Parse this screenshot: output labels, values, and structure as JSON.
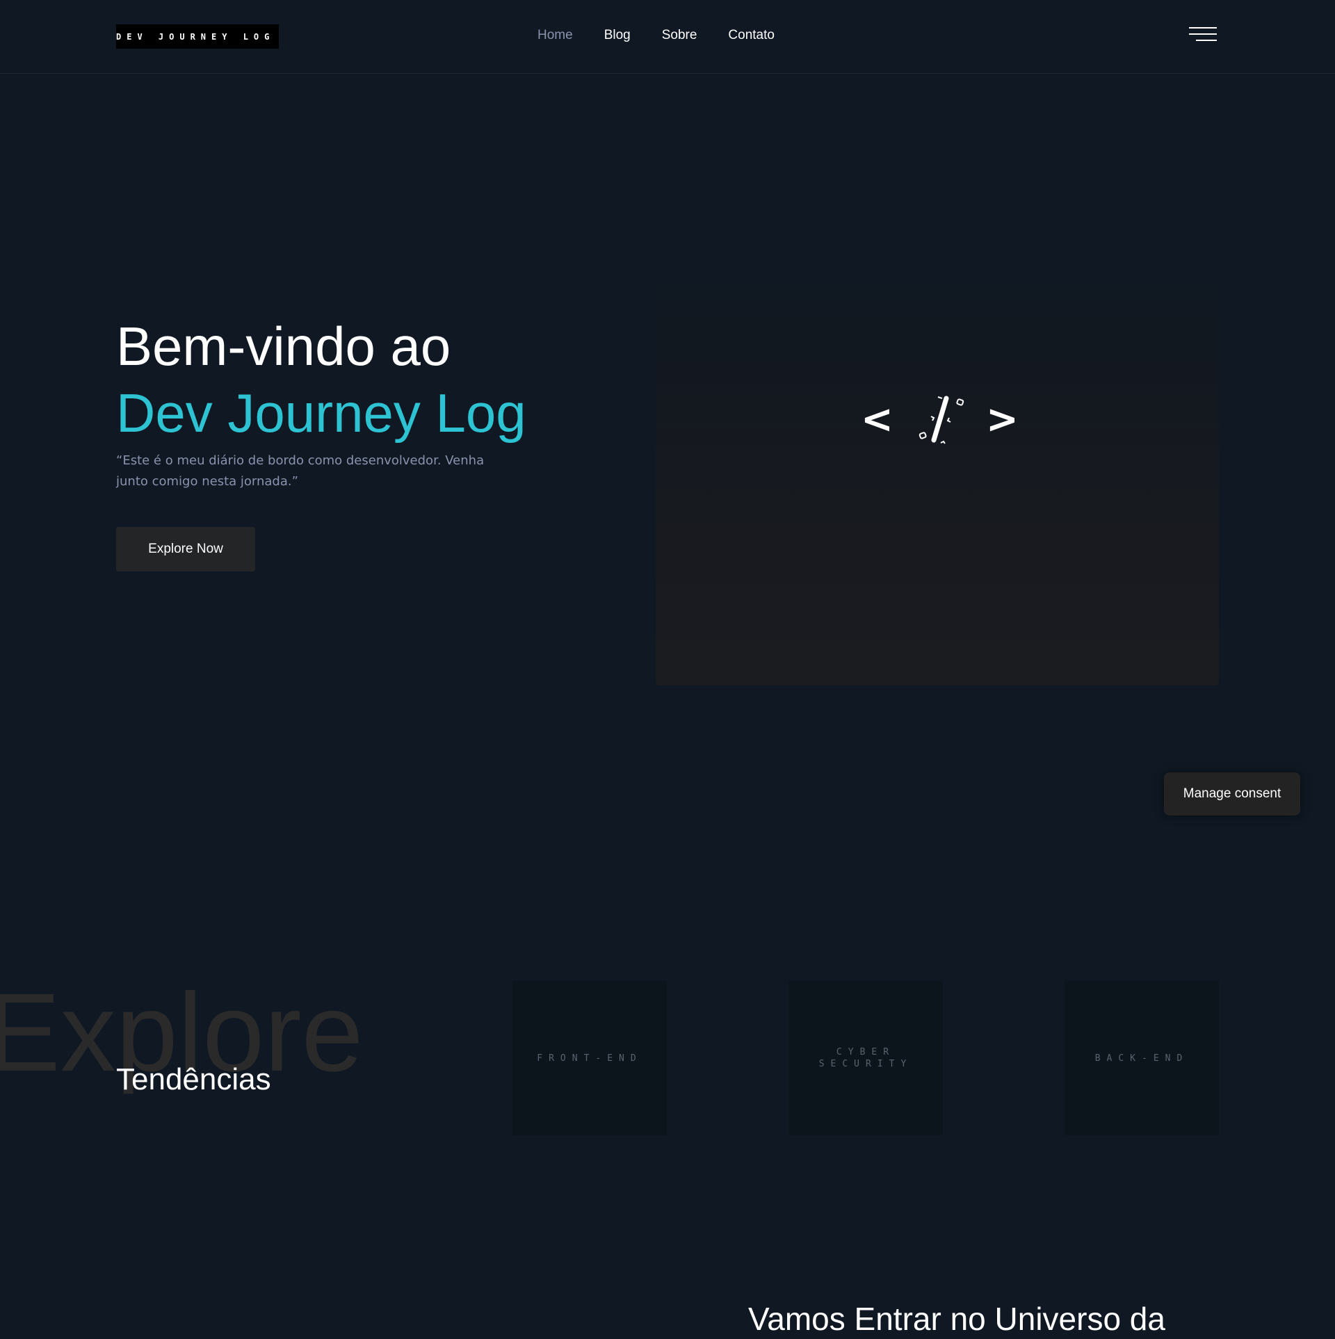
{
  "header": {
    "logo_text": "DEV JOURNEY LOG",
    "nav": [
      {
        "label": "Home",
        "active": true
      },
      {
        "label": "Blog",
        "active": false
      },
      {
        "label": "Sobre",
        "active": false
      },
      {
        "label": "Contato",
        "active": false
      }
    ],
    "menu_icon": "hamburger-menu-icon"
  },
  "hero": {
    "title_line1": "Bem-vindo ao",
    "title_line2": "Dev Journey Log",
    "quote": "“Este é o meu diário de bordo como desenvolvedor. Venha junto comigo nesta jornada.”",
    "cta_label": "Explore Now",
    "visual": {
      "left_glyph": "<",
      "right_glyph": ">",
      "icon": "code-slash-icon"
    }
  },
  "consent": {
    "label": "Manage consent"
  },
  "trends": {
    "background_word": "Explore",
    "title": "Tendências",
    "cards": [
      {
        "label": "FRONT-END"
      },
      {
        "label": "CYBER\nSECURITY"
      },
      {
        "label": "BACK-END"
      }
    ]
  },
  "next_section": {
    "title": "Vamos Entrar no Universo da"
  },
  "colors": {
    "background": "#0f1823",
    "accent": "#2ec3d3",
    "muted_text": "#8a93ad",
    "button_bg": "#242527",
    "card_bg": "#0c141c"
  }
}
